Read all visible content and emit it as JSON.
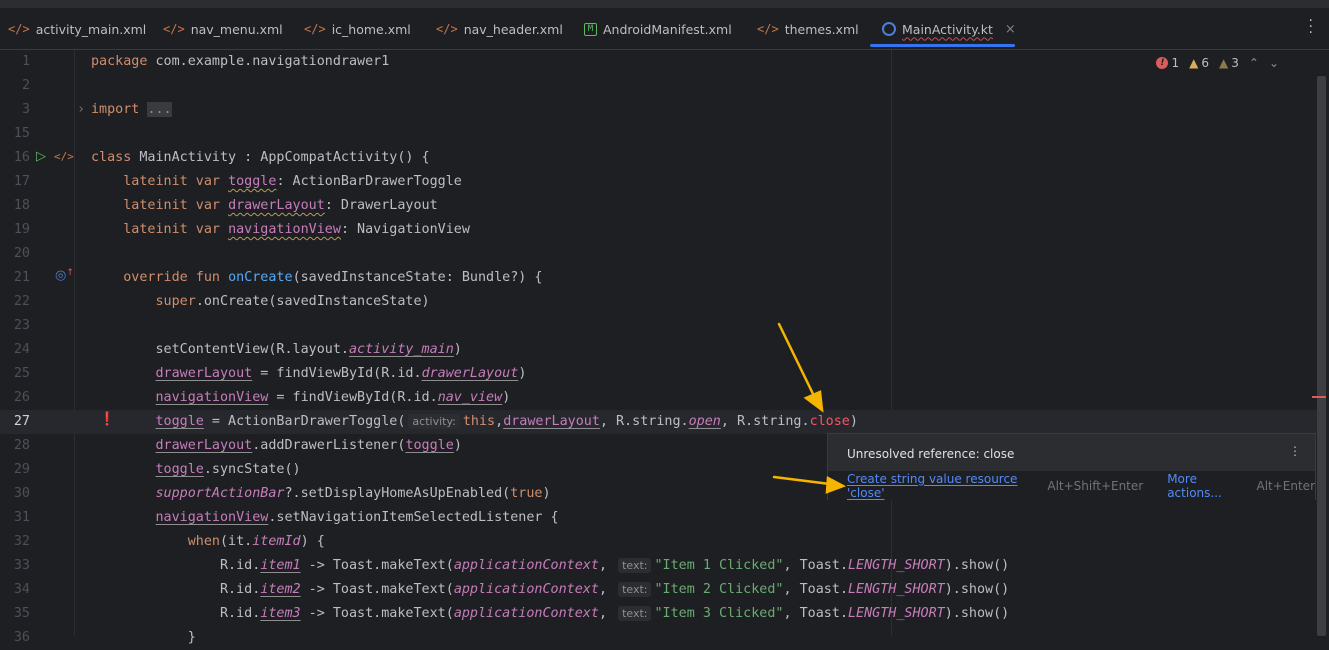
{
  "tabs": [
    {
      "label": "activity_main.xml",
      "icon": "xml-icon"
    },
    {
      "label": "nav_menu.xml",
      "icon": "xml-icon"
    },
    {
      "label": "ic_home.xml",
      "icon": "xml-icon"
    },
    {
      "label": "nav_header.xml",
      "icon": "xml-icon"
    },
    {
      "label": "AndroidManifest.xml",
      "icon": "manifest-icon",
      "glyph": "M"
    },
    {
      "label": "themes.xml",
      "icon": "xml-icon"
    },
    {
      "label": "MainActivity.kt",
      "icon": "kotlin-class-icon",
      "active": true,
      "close": "×"
    }
  ],
  "xml_glyph": "</>",
  "inspections": {
    "errors": "1",
    "warnings": "6",
    "weak_warnings": "3"
  },
  "lines": [
    {
      "n": "1",
      "t": [
        [
          "package",
          "kw"
        ],
        [
          " com.example.navigationdrawer1",
          ""
        ]
      ]
    },
    {
      "n": "2",
      "t": []
    },
    {
      "n": "3",
      "t": [
        [
          "import",
          "kw"
        ],
        [
          " ",
          ""
        ],
        [
          "...",
          "fold"
        ]
      ]
    },
    {
      "n": "15",
      "t": []
    },
    {
      "n": "16",
      "t": [
        [
          "class",
          "kw"
        ],
        [
          " MainActivity : AppCompatActivity() {",
          ""
        ]
      ]
    },
    {
      "n": "17",
      "t": [
        [
          "    lateinit var ",
          "kw"
        ],
        [
          "toggle",
          "prop wavy"
        ],
        [
          ": ActionBarDrawerToggle",
          ""
        ]
      ]
    },
    {
      "n": "18",
      "t": [
        [
          "    lateinit var ",
          "kw"
        ],
        [
          "drawerLayout",
          "prop wavy"
        ],
        [
          ": DrawerLayout",
          ""
        ]
      ]
    },
    {
      "n": "19",
      "t": [
        [
          "    lateinit var ",
          "kw"
        ],
        [
          "navigationView",
          "prop wavy"
        ],
        [
          ": NavigationView",
          ""
        ]
      ]
    },
    {
      "n": "20",
      "t": []
    },
    {
      "n": "21",
      "t": [
        [
          "    override fun ",
          "kw"
        ],
        [
          "onCreate",
          "fn"
        ],
        [
          "(savedInstanceState: Bundle?) {",
          ""
        ]
      ]
    },
    {
      "n": "22",
      "t": [
        [
          "        ",
          ""
        ],
        [
          "super",
          "kw"
        ],
        [
          ".onCreate(savedInstanceState)",
          ""
        ]
      ]
    },
    {
      "n": "23",
      "t": []
    },
    {
      "n": "24",
      "t": [
        [
          "        setContentView(R.layout.",
          ""
        ],
        [
          "activity_main",
          "prop it ul"
        ],
        [
          ")",
          ""
        ]
      ]
    },
    {
      "n": "25",
      "t": [
        [
          "        ",
          ""
        ],
        [
          "drawerLayout",
          "prop ul"
        ],
        [
          " = findViewById(R.id.",
          ""
        ],
        [
          "drawerLayout",
          "prop it ul"
        ],
        [
          ")",
          ""
        ]
      ]
    },
    {
      "n": "26",
      "t": [
        [
          "        ",
          ""
        ],
        [
          "navigationView",
          "prop ul"
        ],
        [
          " = findViewById(R.id.",
          ""
        ],
        [
          "nav_view",
          "prop it ul"
        ],
        [
          ")",
          ""
        ]
      ]
    },
    {
      "n": "27",
      "t": [
        [
          "        ",
          ""
        ],
        [
          "toggle",
          "prop ul"
        ],
        [
          " = ActionBarDrawerToggle(",
          ""
        ],
        [
          "activity:",
          "hint"
        ],
        [
          "this",
          "kw"
        ],
        [
          ",",
          ""
        ],
        [
          "drawerLayout",
          "prop ul"
        ],
        [
          ", R.string.",
          ""
        ],
        [
          "open",
          "prop it ul"
        ],
        [
          ", R.string.",
          ""
        ],
        [
          "close",
          "err"
        ],
        [
          ")",
          ""
        ]
      ],
      "current": true
    },
    {
      "n": "28",
      "t": [
        [
          "        ",
          ""
        ],
        [
          "drawerLayout",
          "prop ul"
        ],
        [
          ".addDrawerListener(",
          ""
        ],
        [
          "toggle",
          "prop ul"
        ],
        [
          ")",
          ""
        ]
      ]
    },
    {
      "n": "29",
      "t": [
        [
          "        ",
          ""
        ],
        [
          "toggle",
          "prop ul"
        ],
        [
          ".syncState()",
          ""
        ]
      ]
    },
    {
      "n": "30",
      "t": [
        [
          "        ",
          ""
        ],
        [
          "supportActionBar",
          "prop it"
        ],
        [
          "?.setDisplayHomeAsUpEnabled(",
          ""
        ],
        [
          "true",
          "kw"
        ],
        [
          ")",
          ""
        ]
      ]
    },
    {
      "n": "31",
      "t": [
        [
          "        ",
          ""
        ],
        [
          "navigationView",
          "prop ul"
        ],
        [
          ".setNavigationItemSelectedListener {",
          ""
        ]
      ]
    },
    {
      "n": "32",
      "t": [
        [
          "            ",
          ""
        ],
        [
          "when",
          "kw"
        ],
        [
          "(it.",
          ""
        ],
        [
          "itemId",
          "prop it"
        ],
        [
          ") {",
          ""
        ]
      ]
    },
    {
      "n": "33",
      "t": [
        [
          "                R.id.",
          ""
        ],
        [
          "item1",
          "prop it ul"
        ],
        [
          " -> Toast.makeText(",
          ""
        ],
        [
          "applicationContext",
          "prop it"
        ],
        [
          ", ",
          ""
        ],
        [
          "text:",
          "hint"
        ],
        [
          "\"Item 1 Clicked\"",
          "str"
        ],
        [
          ", Toast.",
          ""
        ],
        [
          "LENGTH_SHORT",
          "prop it"
        ],
        [
          ").show()",
          ""
        ]
      ]
    },
    {
      "n": "34",
      "t": [
        [
          "                R.id.",
          ""
        ],
        [
          "item2",
          "prop it ul"
        ],
        [
          " -> Toast.makeText(",
          ""
        ],
        [
          "applicationContext",
          "prop it"
        ],
        [
          ", ",
          ""
        ],
        [
          "text:",
          "hint"
        ],
        [
          "\"Item 2 Clicked\"",
          "str"
        ],
        [
          ", Toast.",
          ""
        ],
        [
          "LENGTH_SHORT",
          "prop it"
        ],
        [
          ").show()",
          ""
        ]
      ]
    },
    {
      "n": "35",
      "t": [
        [
          "                R.id.",
          ""
        ],
        [
          "item3",
          "prop it ul"
        ],
        [
          " -> Toast.makeText(",
          ""
        ],
        [
          "applicationContext",
          "prop it"
        ],
        [
          ", ",
          ""
        ],
        [
          "text:",
          "hint"
        ],
        [
          "\"Item 3 Clicked\"",
          "str"
        ],
        [
          ", Toast.",
          ""
        ],
        [
          "LENGTH_SHORT",
          "prop it"
        ],
        [
          ").show()",
          ""
        ]
      ]
    },
    {
      "n": "36",
      "t": [
        [
          "            }",
          ""
        ]
      ]
    }
  ],
  "popup": {
    "message": "Unresolved reference: close",
    "fix_label": "Create string value resource 'close'",
    "fix_shortcut": "Alt+Shift+Enter",
    "more_label": "More actions...",
    "more_shortcut": "Alt+Enter"
  },
  "colors": {
    "accent": "#3574f0",
    "error": "#f75464",
    "annotation_arrow": "#f5b400"
  }
}
